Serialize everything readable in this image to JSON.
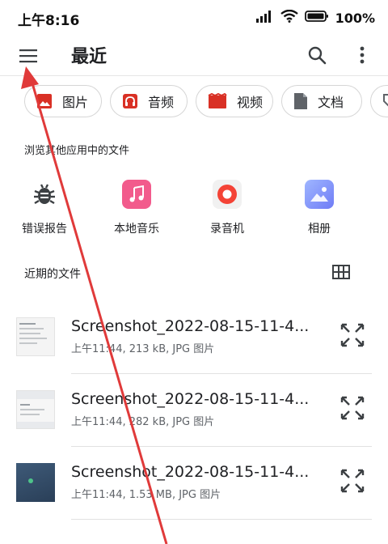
{
  "status_bar": {
    "time": "上午8:16",
    "battery_percent": "100%"
  },
  "app_bar": {
    "title": "最近"
  },
  "chips": [
    {
      "label": "图片",
      "icon": "image-icon",
      "color": "#d93025"
    },
    {
      "label": "音频",
      "icon": "headphones-icon",
      "color": "#d93025"
    },
    {
      "label": "视频",
      "icon": "film-icon",
      "color": "#d93025"
    },
    {
      "label": "文档",
      "icon": "document-icon",
      "color": "#5f6368"
    }
  ],
  "apps_section": {
    "label": "浏览其他应用中的文件",
    "apps": [
      {
        "label": "错误报告",
        "icon": "bug-icon"
      },
      {
        "label": "本地音乐",
        "icon": "music-note-icon",
        "color": "#f25b8c"
      },
      {
        "label": "录音机",
        "icon": "record-icon",
        "color": "#f44336"
      },
      {
        "label": "相册",
        "icon": "gallery-icon",
        "color": "#7b8cff"
      }
    ]
  },
  "recent_section": {
    "label": "近期的文件",
    "files": [
      {
        "name": "Screenshot_2022-08-15-11-4...",
        "meta": "上午11:44, 213 kB, JPG 图片"
      },
      {
        "name": "Screenshot_2022-08-15-11-4...",
        "meta": "上午11:44, 282 kB, JPG 图片"
      },
      {
        "name": "Screenshot_2022-08-15-11-4...",
        "meta": "上午11:44, 1.53 MB, JPG 图片"
      }
    ]
  },
  "colors": {
    "annotation_arrow": "#e03a3a",
    "text_primary": "#202124",
    "text_secondary": "#5f6368"
  }
}
